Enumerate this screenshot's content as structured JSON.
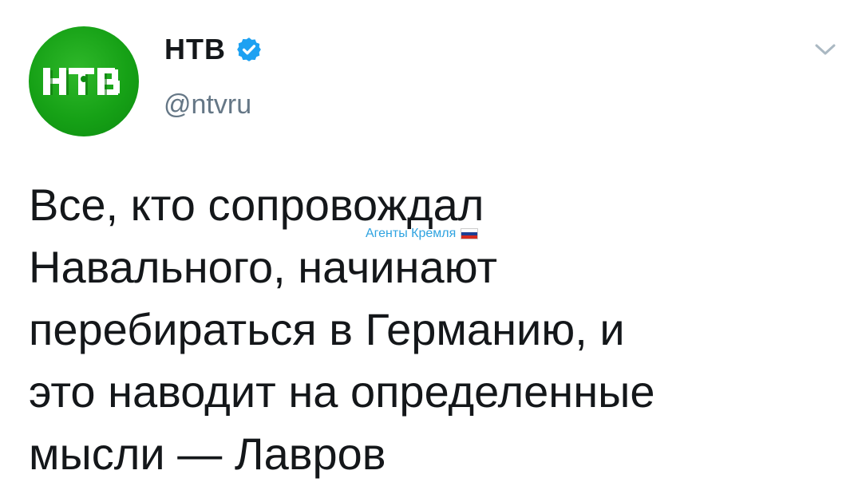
{
  "tweet": {
    "avatar_label": "НТВ",
    "display_name": "НТВ",
    "verified": true,
    "handle": "@ntvru",
    "text_lines": [
      "Все, кто сопровождал",
      "Навального, начинают",
      "перебираться в Германию, и",
      "это наводит на определенные",
      "мысли — Лавров"
    ]
  },
  "watermark": {
    "text": "Агенты Кремля",
    "flag_colors": [
      "#ffffff",
      "#1c3f94",
      "#d52b1e"
    ]
  },
  "icons": {
    "verified": "verified-badge-icon",
    "menu": "chevron-down-icon"
  },
  "colors": {
    "brand_green": "#16a116",
    "verified_blue": "#1da1f2",
    "handle_gray": "#657786",
    "text": "#14171a"
  }
}
